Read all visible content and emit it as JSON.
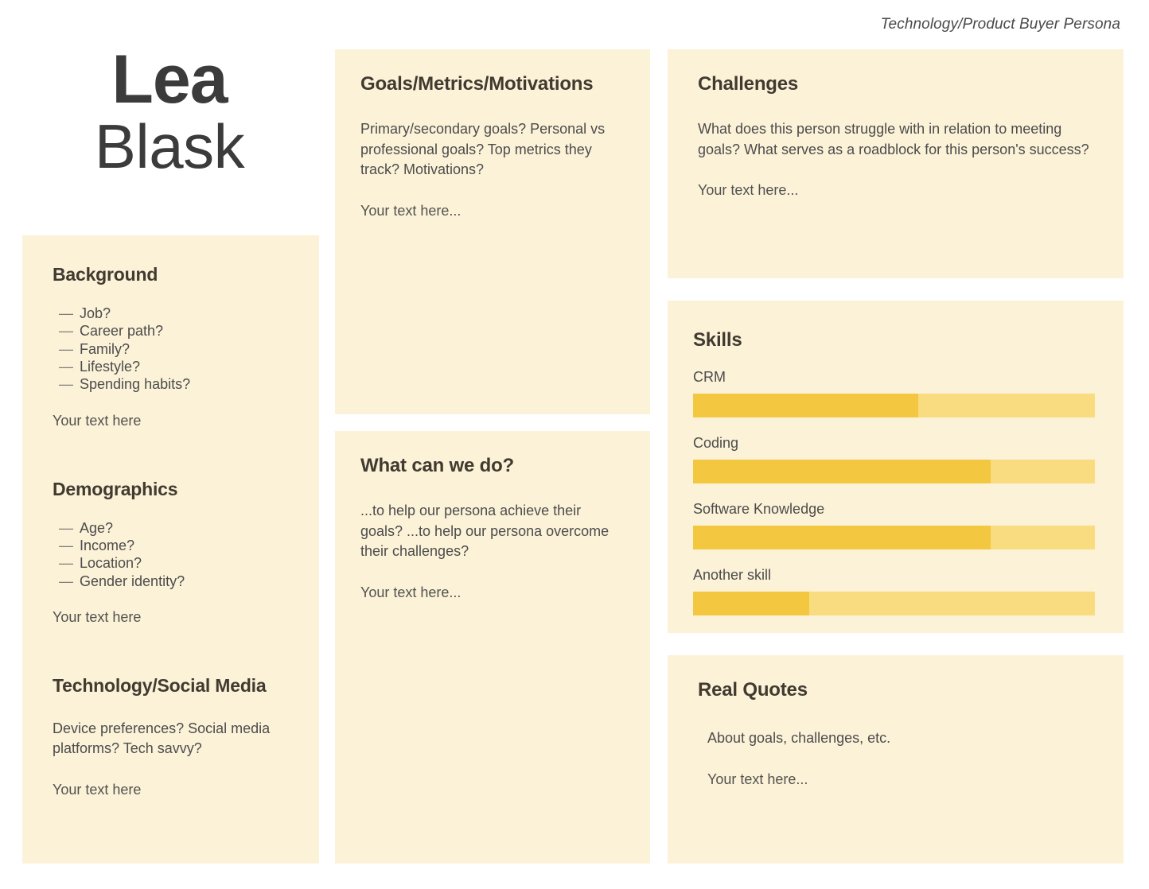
{
  "header": {
    "doc_label": "Technology/Product Buyer Persona"
  },
  "persona": {
    "first_name": "Lea",
    "last_name": "Blask"
  },
  "left_column": {
    "background": {
      "title": "Background",
      "items": [
        "Job?",
        "Career path?",
        "Family?",
        "Lifestyle?",
        "Spending habits?"
      ],
      "placeholder": "Your text here"
    },
    "demographics": {
      "title": "Demographics",
      "items": [
        "Age?",
        "Income?",
        "Location?",
        "Gender identity?"
      ],
      "placeholder": "Your text here"
    },
    "technology": {
      "title": "Technology/Social Media",
      "body": "Device preferences? Social media platforms? Tech savvy?",
      "placeholder": "Your text here"
    }
  },
  "middle_column": {
    "goals": {
      "title": "Goals/Metrics/Motivations",
      "body": "Primary/secondary goals? Personal vs professional goals? Top metrics they track? Motivations?",
      "placeholder": "Your text here..."
    },
    "what_can_we_do": {
      "title": "What can we do?",
      "body": "...to help our persona achieve their goals? ...to help our persona overcome their challenges?",
      "placeholder": "Your text here..."
    }
  },
  "right_column": {
    "challenges": {
      "title": "Challenges",
      "body": "What does this person struggle with in relation to meeting goals? What serves as a roadblock for this person's success?",
      "placeholder": "Your text here..."
    },
    "skills": {
      "title": "Skills",
      "items": [
        {
          "label": "CRM",
          "value": 56
        },
        {
          "label": "Coding",
          "value": 74
        },
        {
          "label": "Software Knowledge",
          "value": 74
        },
        {
          "label": "Another skill",
          "value": 29
        }
      ]
    },
    "quotes": {
      "title": "Real Quotes",
      "body": "About goals, challenges, etc.",
      "placeholder": "Your text here..."
    }
  },
  "bullet_dash": "—",
  "colors": {
    "card_background": "#fcf2d8",
    "bar_track": "#fadc80",
    "bar_fill": "#f3c840",
    "heading": "#413a30",
    "body": "#4c4c4c",
    "name": "#3b3b3b"
  }
}
